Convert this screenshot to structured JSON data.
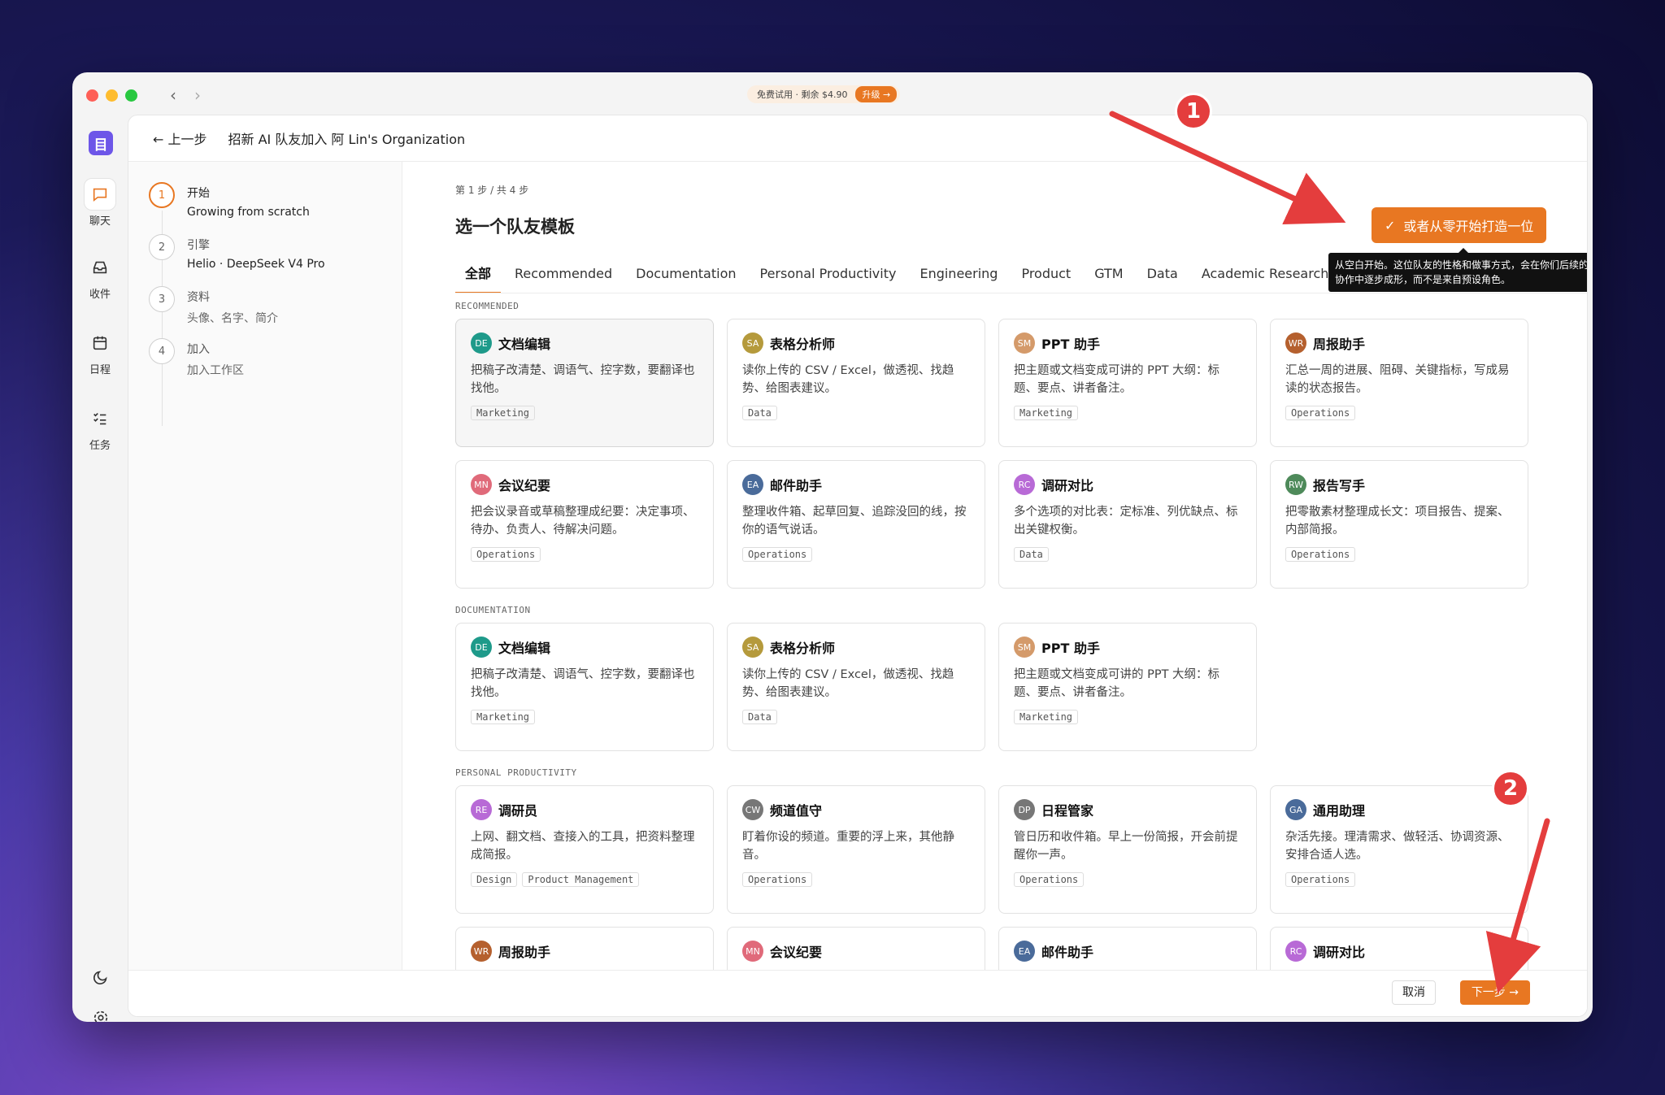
{
  "titlebar": {
    "trial_text": "免费试用 · 剩余 $4.90",
    "upgrade_label": "升级 →"
  },
  "rail": {
    "logo": "目",
    "items": [
      {
        "label": "聊天",
        "icon": "chat-icon"
      },
      {
        "label": "收件",
        "icon": "inbox-icon"
      },
      {
        "label": "日程",
        "icon": "calendar-icon"
      },
      {
        "label": "任务",
        "icon": "tasks-icon"
      }
    ]
  },
  "header": {
    "back_label": "← 上一步",
    "title": "招新 AI 队友加入 阿 Lin's Organization"
  },
  "steps": [
    {
      "num": "1",
      "title": "开始",
      "sub": "Growing from scratch"
    },
    {
      "num": "2",
      "title": "引擎",
      "sub": "Helio · DeepSeek V4 Pro"
    },
    {
      "num": "3",
      "title": "资料",
      "sub": "头像、名字、简介"
    },
    {
      "num": "4",
      "title": "加入",
      "sub": "加入工作区"
    }
  ],
  "content": {
    "crumb": "第 1 步 / 共 4 步",
    "title": "选一个队友模板",
    "scratch_button": "或者从零开始打造一位",
    "scratch_check": "✓",
    "tooltip": "从空白开始。这位队友的性格和做事方式，会在你们后续的协作中逐步成形，而不是来自预设角色。",
    "tabs": [
      "全部",
      "Recommended",
      "Documentation",
      "Personal Productivity",
      "Engineering",
      "Product",
      "GTM",
      "Data",
      "Academic Research"
    ]
  },
  "sections": [
    {
      "label": "RECOMMENDED",
      "cards": [
        {
          "abbr": "DE",
          "color": "#1e9a8a",
          "name": "文档编辑",
          "desc": "把稿子改清楚、调语气、控字数，要翻译也找他。",
          "tags": [
            "Marketing"
          ]
        },
        {
          "abbr": "SA",
          "color": "#b59a3c",
          "name": "表格分析师",
          "desc": "读你上传的 CSV / Excel，做透视、找趋势、给图表建议。",
          "tags": [
            "Data"
          ]
        },
        {
          "abbr": "SM",
          "color": "#d49a6a",
          "name": "PPT 助手",
          "desc": "把主题或文档变成可讲的 PPT 大纲：标题、要点、讲者备注。",
          "tags": [
            "Marketing"
          ]
        },
        {
          "abbr": "WR",
          "color": "#b5602e",
          "name": "周报助手",
          "desc": "汇总一周的进展、阻碍、关键指标，写成易读的状态报告。",
          "tags": [
            "Operations"
          ]
        },
        {
          "abbr": "MN",
          "color": "#e06a7a",
          "name": "会议纪要",
          "desc": "把会议录音或草稿整理成纪要：决定事项、待办、负责人、待解决问题。",
          "tags": [
            "Operations"
          ]
        },
        {
          "abbr": "EA",
          "color": "#4a6b9a",
          "name": "邮件助手",
          "desc": "整理收件箱、起草回复、追踪没回的线，按你的语气说话。",
          "tags": [
            "Operations"
          ]
        },
        {
          "abbr": "RC",
          "color": "#b86ad6",
          "name": "调研对比",
          "desc": "多个选项的对比表：定标准、列优缺点、标出关键权衡。",
          "tags": [
            "Data"
          ]
        },
        {
          "abbr": "RW",
          "color": "#4e8a5a",
          "name": "报告写手",
          "desc": "把零散素材整理成长文：项目报告、提案、内部简报。",
          "tags": [
            "Operations"
          ]
        }
      ]
    },
    {
      "label": "DOCUMENTATION",
      "cards": [
        {
          "abbr": "DE",
          "color": "#1e9a8a",
          "name": "文档编辑",
          "desc": "把稿子改清楚、调语气、控字数，要翻译也找他。",
          "tags": [
            "Marketing"
          ]
        },
        {
          "abbr": "SA",
          "color": "#b59a3c",
          "name": "表格分析师",
          "desc": "读你上传的 CSV / Excel，做透视、找趋势、给图表建议。",
          "tags": [
            "Data"
          ]
        },
        {
          "abbr": "SM",
          "color": "#d49a6a",
          "name": "PPT 助手",
          "desc": "把主题或文档变成可讲的 PPT 大纲：标题、要点、讲者备注。",
          "tags": [
            "Marketing"
          ]
        }
      ]
    },
    {
      "label": "PERSONAL PRODUCTIVITY",
      "cards": [
        {
          "abbr": "RE",
          "color": "#b86ad6",
          "name": "调研员",
          "desc": "上网、翻文档、查接入的工具，把资料整理成简报。",
          "tags": [
            "Design",
            "Product Management"
          ]
        },
        {
          "abbr": "CW",
          "color": "#777777",
          "name": "频道值守",
          "desc": "盯着你设的频道。重要的浮上来，其他静音。",
          "tags": [
            "Operations"
          ]
        },
        {
          "abbr": "DP",
          "color": "#777777",
          "name": "日程管家",
          "desc": "管日历和收件箱。早上一份简报，开会前提醒你一声。",
          "tags": [
            "Operations"
          ]
        },
        {
          "abbr": "GA",
          "color": "#4a6b9a",
          "name": "通用助理",
          "desc": "杂活先接。理清需求、做轻活、协调资源、安排合适人选。",
          "tags": [
            "Operations"
          ]
        },
        {
          "abbr": "WR",
          "color": "#b5602e",
          "name": "周报助手",
          "desc": "",
          "tags": []
        },
        {
          "abbr": "MN",
          "color": "#e06a7a",
          "name": "会议纪要",
          "desc": "",
          "tags": []
        },
        {
          "abbr": "EA",
          "color": "#4a6b9a",
          "name": "邮件助手",
          "desc": "",
          "tags": []
        },
        {
          "abbr": "RC",
          "color": "#b86ad6",
          "name": "调研对比",
          "desc": "",
          "tags": []
        }
      ]
    }
  ],
  "footer": {
    "cancel_label": "取消",
    "next_label": "下一步 →"
  },
  "annotations": {
    "one": "1",
    "two": "2",
    "arrow_color": "#e43d3d"
  }
}
